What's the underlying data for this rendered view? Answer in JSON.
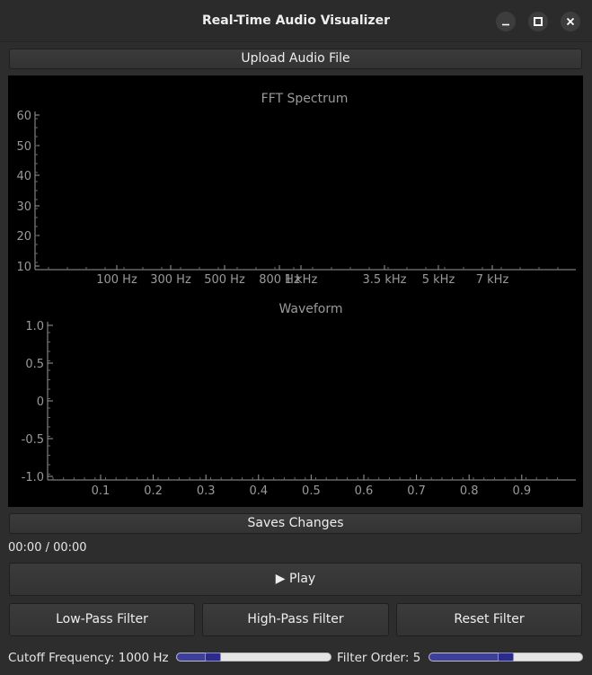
{
  "window": {
    "title": "Real-Time Audio Visualizer"
  },
  "toolbar": {
    "upload_label": "Upload Audio File",
    "save_label": "Saves Changes"
  },
  "fft": {
    "title": "FFT Spectrum",
    "y_ticks": [
      "60",
      "50",
      "40",
      "30",
      "20",
      "10"
    ],
    "x_ticks": [
      "100 Hz",
      "300 Hz",
      "500 Hz",
      "800 Hz",
      "1 kHz",
      "3.5 kHz",
      "5 kHz",
      "7 kHz"
    ]
  },
  "waveform": {
    "title": "Waveform",
    "y_ticks": [
      "1.0",
      "0.5",
      "0",
      "-0.5",
      "-1.0"
    ],
    "x_ticks": [
      "0.1",
      "0.2",
      "0.3",
      "0.4",
      "0.5",
      "0.6",
      "0.7",
      "0.8",
      "0.9"
    ]
  },
  "playback": {
    "time": "00:00 / 00:00",
    "play_label": "▶ Play"
  },
  "filters": {
    "low_pass_label": "Low-Pass Filter",
    "high_pass_label": "High-Pass Filter",
    "reset_label": "Reset Filter"
  },
  "controls": {
    "cutoff_label": "Cutoff Frequency: 1000 Hz",
    "cutoff_value_fraction": 0.2,
    "order_label": "Filter Order: 5",
    "order_value_fraction": 0.5
  },
  "colors": {
    "window_bg": "#2d2d2d",
    "plot_bg": "#000000",
    "slider_fill": "#3e3f9c",
    "axis": "#9a9a9a"
  }
}
